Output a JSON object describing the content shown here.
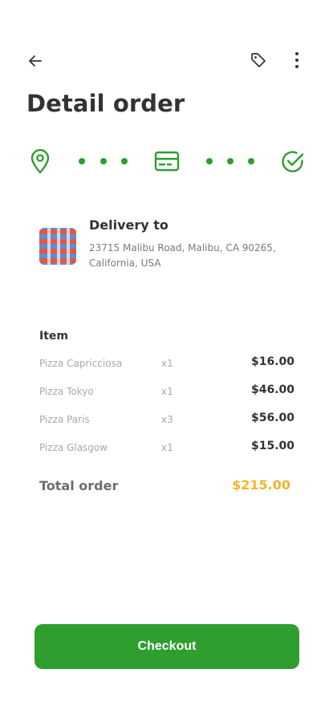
{
  "header": {
    "title": "Detail order"
  },
  "delivery": {
    "title": "Delivery to",
    "address": "23715 Malibu Road, Malibu, CA 90265, California, USA"
  },
  "items": {
    "header": "Item",
    "rows": [
      {
        "name": "Pizza Capricciosa",
        "qty": "x1",
        "price": "$16.00"
      },
      {
        "name": "Pizza Tokyo",
        "qty": "x1",
        "price": "$46.00"
      },
      {
        "name": "Pizza Paris",
        "qty": "x3",
        "price": "$56.00"
      },
      {
        "name": "Pizza Glasgow",
        "qty": "x1",
        "price": "$15.00"
      }
    ],
    "total_label": "Total order",
    "total_value": "$215.00"
  },
  "actions": {
    "checkout_label": "Checkout"
  },
  "icons": {
    "back": "arrow-left-icon",
    "tag": "tag-icon",
    "more": "more-vertical-icon",
    "location": "location-pin-icon",
    "card": "credit-card-icon",
    "done": "check-circle-icon"
  },
  "colors": {
    "primary": "#2e9e2e",
    "total": "#f2b52c"
  }
}
